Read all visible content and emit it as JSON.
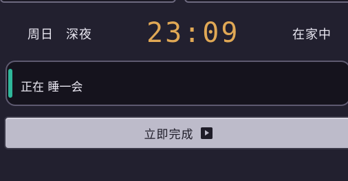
{
  "status": {
    "day": "周日",
    "period": "深夜",
    "time": "23:09",
    "location": "在家中"
  },
  "activity": {
    "text": "正在 睡一会"
  },
  "action": {
    "complete_label": "立即完成",
    "complete_icon": "play-square-icon"
  },
  "colors": {
    "clock": "#e0a855",
    "accent": "#2fb79a",
    "background": "#22202f",
    "button": "#bdbbca"
  }
}
